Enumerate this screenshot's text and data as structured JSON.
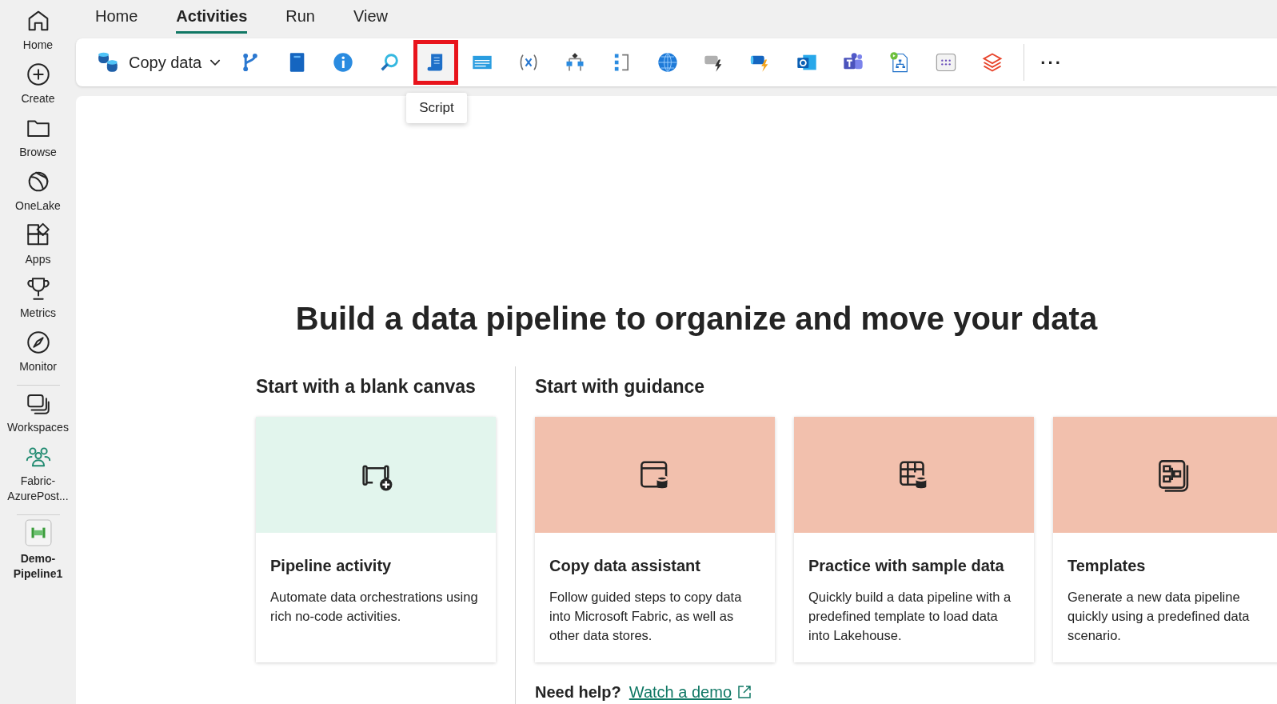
{
  "sidebar": {
    "items": [
      {
        "label": "Home",
        "selected": false
      },
      {
        "label": "Create",
        "selected": false
      },
      {
        "label": "Browse",
        "selected": false
      },
      {
        "label": "OneLake",
        "selected": false
      },
      {
        "label": "Apps",
        "selected": false
      },
      {
        "label": "Metrics",
        "selected": false
      },
      {
        "label": "Monitor",
        "selected": false
      },
      {
        "label": "Workspaces",
        "selected": false
      },
      {
        "label": "Fabric-AzurePost...",
        "selected": false
      },
      {
        "label": "Demo-Pipeline1",
        "selected": true
      }
    ]
  },
  "tabs": [
    {
      "label": "Home",
      "selected": false
    },
    {
      "label": "Activities",
      "selected": true
    },
    {
      "label": "Run",
      "selected": false
    },
    {
      "label": "View",
      "selected": false
    }
  ],
  "toolbar": {
    "copy_data": "Copy data",
    "tools": [
      {
        "selected": false
      },
      {
        "selected": false
      },
      {
        "selected": false
      },
      {
        "selected": false
      },
      {
        "selected": true,
        "tooltip": "Script"
      },
      {
        "selected": false
      },
      {
        "selected": false
      },
      {
        "selected": false
      },
      {
        "selected": false
      },
      {
        "selected": false
      },
      {
        "selected": false
      },
      {
        "selected": false
      },
      {
        "selected": false
      },
      {
        "selected": false
      },
      {
        "selected": false
      },
      {
        "selected": false
      },
      {
        "selected": false
      }
    ],
    "more": "···"
  },
  "main": {
    "heading": "Build a data pipeline to organize and move your data",
    "blank": {
      "title": "Start with a blank canvas",
      "cards": [
        {
          "title": "Pipeline activity",
          "description": "Automate data orchestrations using rich no-code activities."
        }
      ]
    },
    "guidance": {
      "title": "Start with guidance",
      "cards": [
        {
          "title": "Copy data assistant",
          "description": "Follow guided steps to copy data into Microsoft Fabric, as well as other data stores."
        },
        {
          "title": "Practice with sample data",
          "description": "Quickly build a data pipeline with a predefined template to load data into Lakehouse."
        },
        {
          "title": "Templates",
          "description": "Generate a new data pipeline quickly using a predefined data scenario."
        }
      ]
    },
    "help": {
      "label": "Need help?",
      "link": "Watch a demo"
    }
  }
}
